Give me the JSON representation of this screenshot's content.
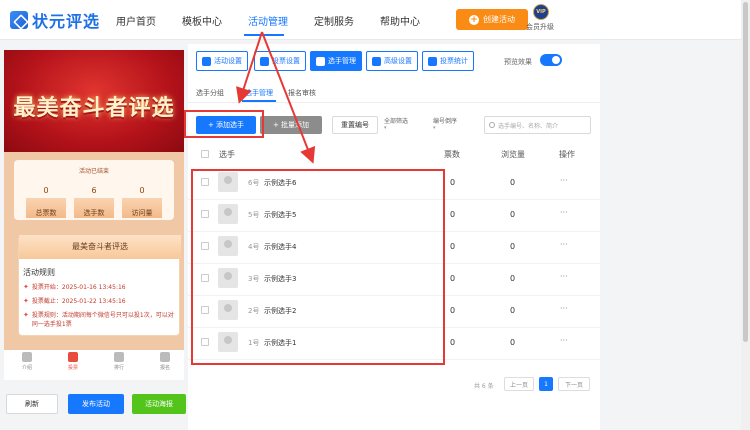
{
  "brand": {
    "name": "状元评选"
  },
  "nav": {
    "items": [
      "用户首页",
      "模板中心",
      "活动管理",
      "定制服务",
      "帮助中心"
    ],
    "create_label": "创建活动",
    "vip_badge": "VIP",
    "vip_label": "会员升级"
  },
  "preview": {
    "banner_title": "最美奋斗者评选",
    "ended": "活动已结束",
    "stats": [
      {
        "value": "0",
        "label": "总票数"
      },
      {
        "value": "6",
        "label": "选手数"
      },
      {
        "value": "0",
        "label": "访问量"
      }
    ],
    "card_title": "最美奋斗者评选",
    "rules_title": "活动规则",
    "rules": [
      "投票开始：2025-01-16 13:45:16",
      "投票截止：2025-01-22 13:45:16",
      "投票规则：活动期间每个微信号只可以投1次，可以对同一选手投1票"
    ],
    "tabs": [
      "介绍",
      "投票",
      "排行",
      "报名"
    ]
  },
  "bottom_buttons": {
    "refresh": "刷新",
    "publish": "发布活动",
    "poster": "活动海报"
  },
  "settings": {
    "buttons": [
      "活动设置",
      "投票设置",
      "选手管理",
      "高级设置",
      "投票统计"
    ],
    "preview_label": "预览效果"
  },
  "subtabs": [
    "选手分组",
    "选手管理",
    "报名审核"
  ],
  "toolbar": {
    "add": "+ 添加选手",
    "batch": "+ 批量添加",
    "reset": "重置编号",
    "filter_all": "全部筛选",
    "sort": "编号倒序",
    "search_placeholder": "选手编号、名称、简介"
  },
  "table": {
    "headers": [
      "选手",
      "票数",
      "浏览量",
      "操作"
    ],
    "rows": [
      {
        "no": "6号",
        "name": "示例选手6",
        "votes": "0",
        "views": "0",
        "op": "···"
      },
      {
        "no": "5号",
        "name": "示例选手5",
        "votes": "0",
        "views": "0",
        "op": "···"
      },
      {
        "no": "4号",
        "name": "示例选手4",
        "votes": "0",
        "views": "0",
        "op": "···"
      },
      {
        "no": "3号",
        "name": "示例选手3",
        "votes": "0",
        "views": "0",
        "op": "···"
      },
      {
        "no": "2号",
        "name": "示例选手2",
        "votes": "0",
        "views": "0",
        "op": "···"
      },
      {
        "no": "1号",
        "name": "示例选手1",
        "votes": "0",
        "views": "0",
        "op": "···"
      }
    ]
  },
  "pager": {
    "total": "共 6 条",
    "prev": "上一页",
    "current": "1",
    "next": "下一页"
  },
  "colors": {
    "primary": "#1677ff",
    "orange": "#fa8c16",
    "annotation": "#e53935",
    "green": "#52c41a"
  }
}
